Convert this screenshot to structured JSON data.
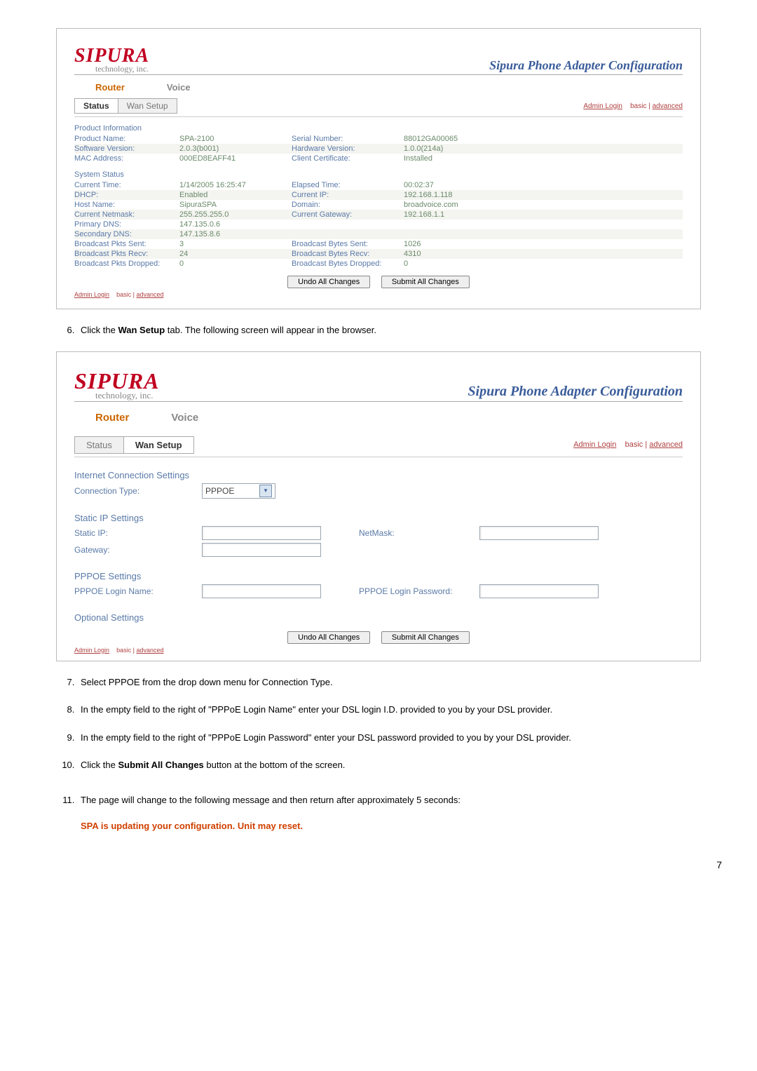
{
  "page_number": "7",
  "logo": {
    "brand": "SIPURA",
    "sub": "technology, inc."
  },
  "config_title": "Sipura Phone Adapter Configuration",
  "main_tabs": {
    "router": "Router",
    "voice": "Voice"
  },
  "subtabs_status": {
    "status": "Status",
    "wan": "Wan Setup"
  },
  "admin_links": {
    "admin": "Admin Login",
    "basic": "basic",
    "sep": " | ",
    "advanced": "advanced"
  },
  "buttons": {
    "undo": "Undo All Changes",
    "submit": "Submit All Changes"
  },
  "ss1": {
    "product_info_head": "Product Information",
    "product_name_l": "Product Name:",
    "product_name_v": "SPA-2100",
    "serial_l": "Serial Number:",
    "serial_v": "88012GA00065",
    "sw_l": "Software Version:",
    "sw_v": "2.0.3(b001)",
    "hw_l": "Hardware Version:",
    "hw_v": "1.0.0(214a)",
    "mac_l": "MAC Address:",
    "mac_v": "000ED8EAFF41",
    "cert_l": "Client Certificate:",
    "cert_v": "Installed",
    "system_head": "System Status",
    "time_l": "Current Time:",
    "time_v": "1/14/2005 16:25:47",
    "elapsed_l": "Elapsed Time:",
    "elapsed_v": "00:02:37",
    "dhcp_l": "DHCP:",
    "dhcp_v": "Enabled",
    "cip_l": "Current IP:",
    "cip_v": "192.168.1.118",
    "host_l": "Host Name:",
    "host_v": "SipuraSPA",
    "domain_l": "Domain:",
    "domain_v": "broadvoice.com",
    "mask_l": "Current Netmask:",
    "mask_v": "255.255.255.0",
    "gw_l": "Current Gateway:",
    "gw_v": "192.168.1.1",
    "pdns_l": "Primary DNS:",
    "pdns_v": "147.135.0.6",
    "sdns_l": "Secondary DNS:",
    "sdns_v": "147.135.8.6",
    "bps_l": "Broadcast Pkts Sent:",
    "bps_v": "3",
    "bbs_l": "Broadcast Bytes Sent:",
    "bbs_v": "1026",
    "bpr_l": "Broadcast Pkts Recv:",
    "bpr_v": "24",
    "bbr_l": "Broadcast Bytes Recv:",
    "bbr_v": "4310",
    "bpd_l": "Broadcast Pkts Dropped:",
    "bpd_v": "0",
    "bbd_l": "Broadcast Bytes Dropped:",
    "bbd_v": "0"
  },
  "step6": {
    "pre": "Click the ",
    "bold": "Wan Setup",
    "post": " tab. The following screen will appear in the browser."
  },
  "ss2": {
    "ics_head": "Internet Connection Settings",
    "conn_l": "Connection Type:",
    "conn_sel": "PPPOE",
    "static_head": "Static IP Settings",
    "sip_l": "Static IP:",
    "netmask_l": "NetMask:",
    "gw_l": "Gateway:",
    "pppoe_head": "PPPOE Settings",
    "plogin_l": "PPPOE Login Name:",
    "ppass_l": "PPPOE Login Password:",
    "opt_head": "Optional Settings"
  },
  "step7": "Select PPPOE from the drop down menu for Connection Type.",
  "step8": "In the empty field to the right of \"PPPoE Login Name\" enter your DSL login I.D. provided to you by your DSL provider.",
  "step9": "In the empty field to the right of \"PPPoE Login Password\" enter your DSL password provided to you by your DSL provider.",
  "step10": {
    "pre": "Click the ",
    "bold": "Submit All Changes",
    "post": " button at the bottom of the screen."
  },
  "step11": "The page will change to the following message and then return after approximately 5 seconds:",
  "update_msg": "SPA is updating your configuration. Unit may reset."
}
